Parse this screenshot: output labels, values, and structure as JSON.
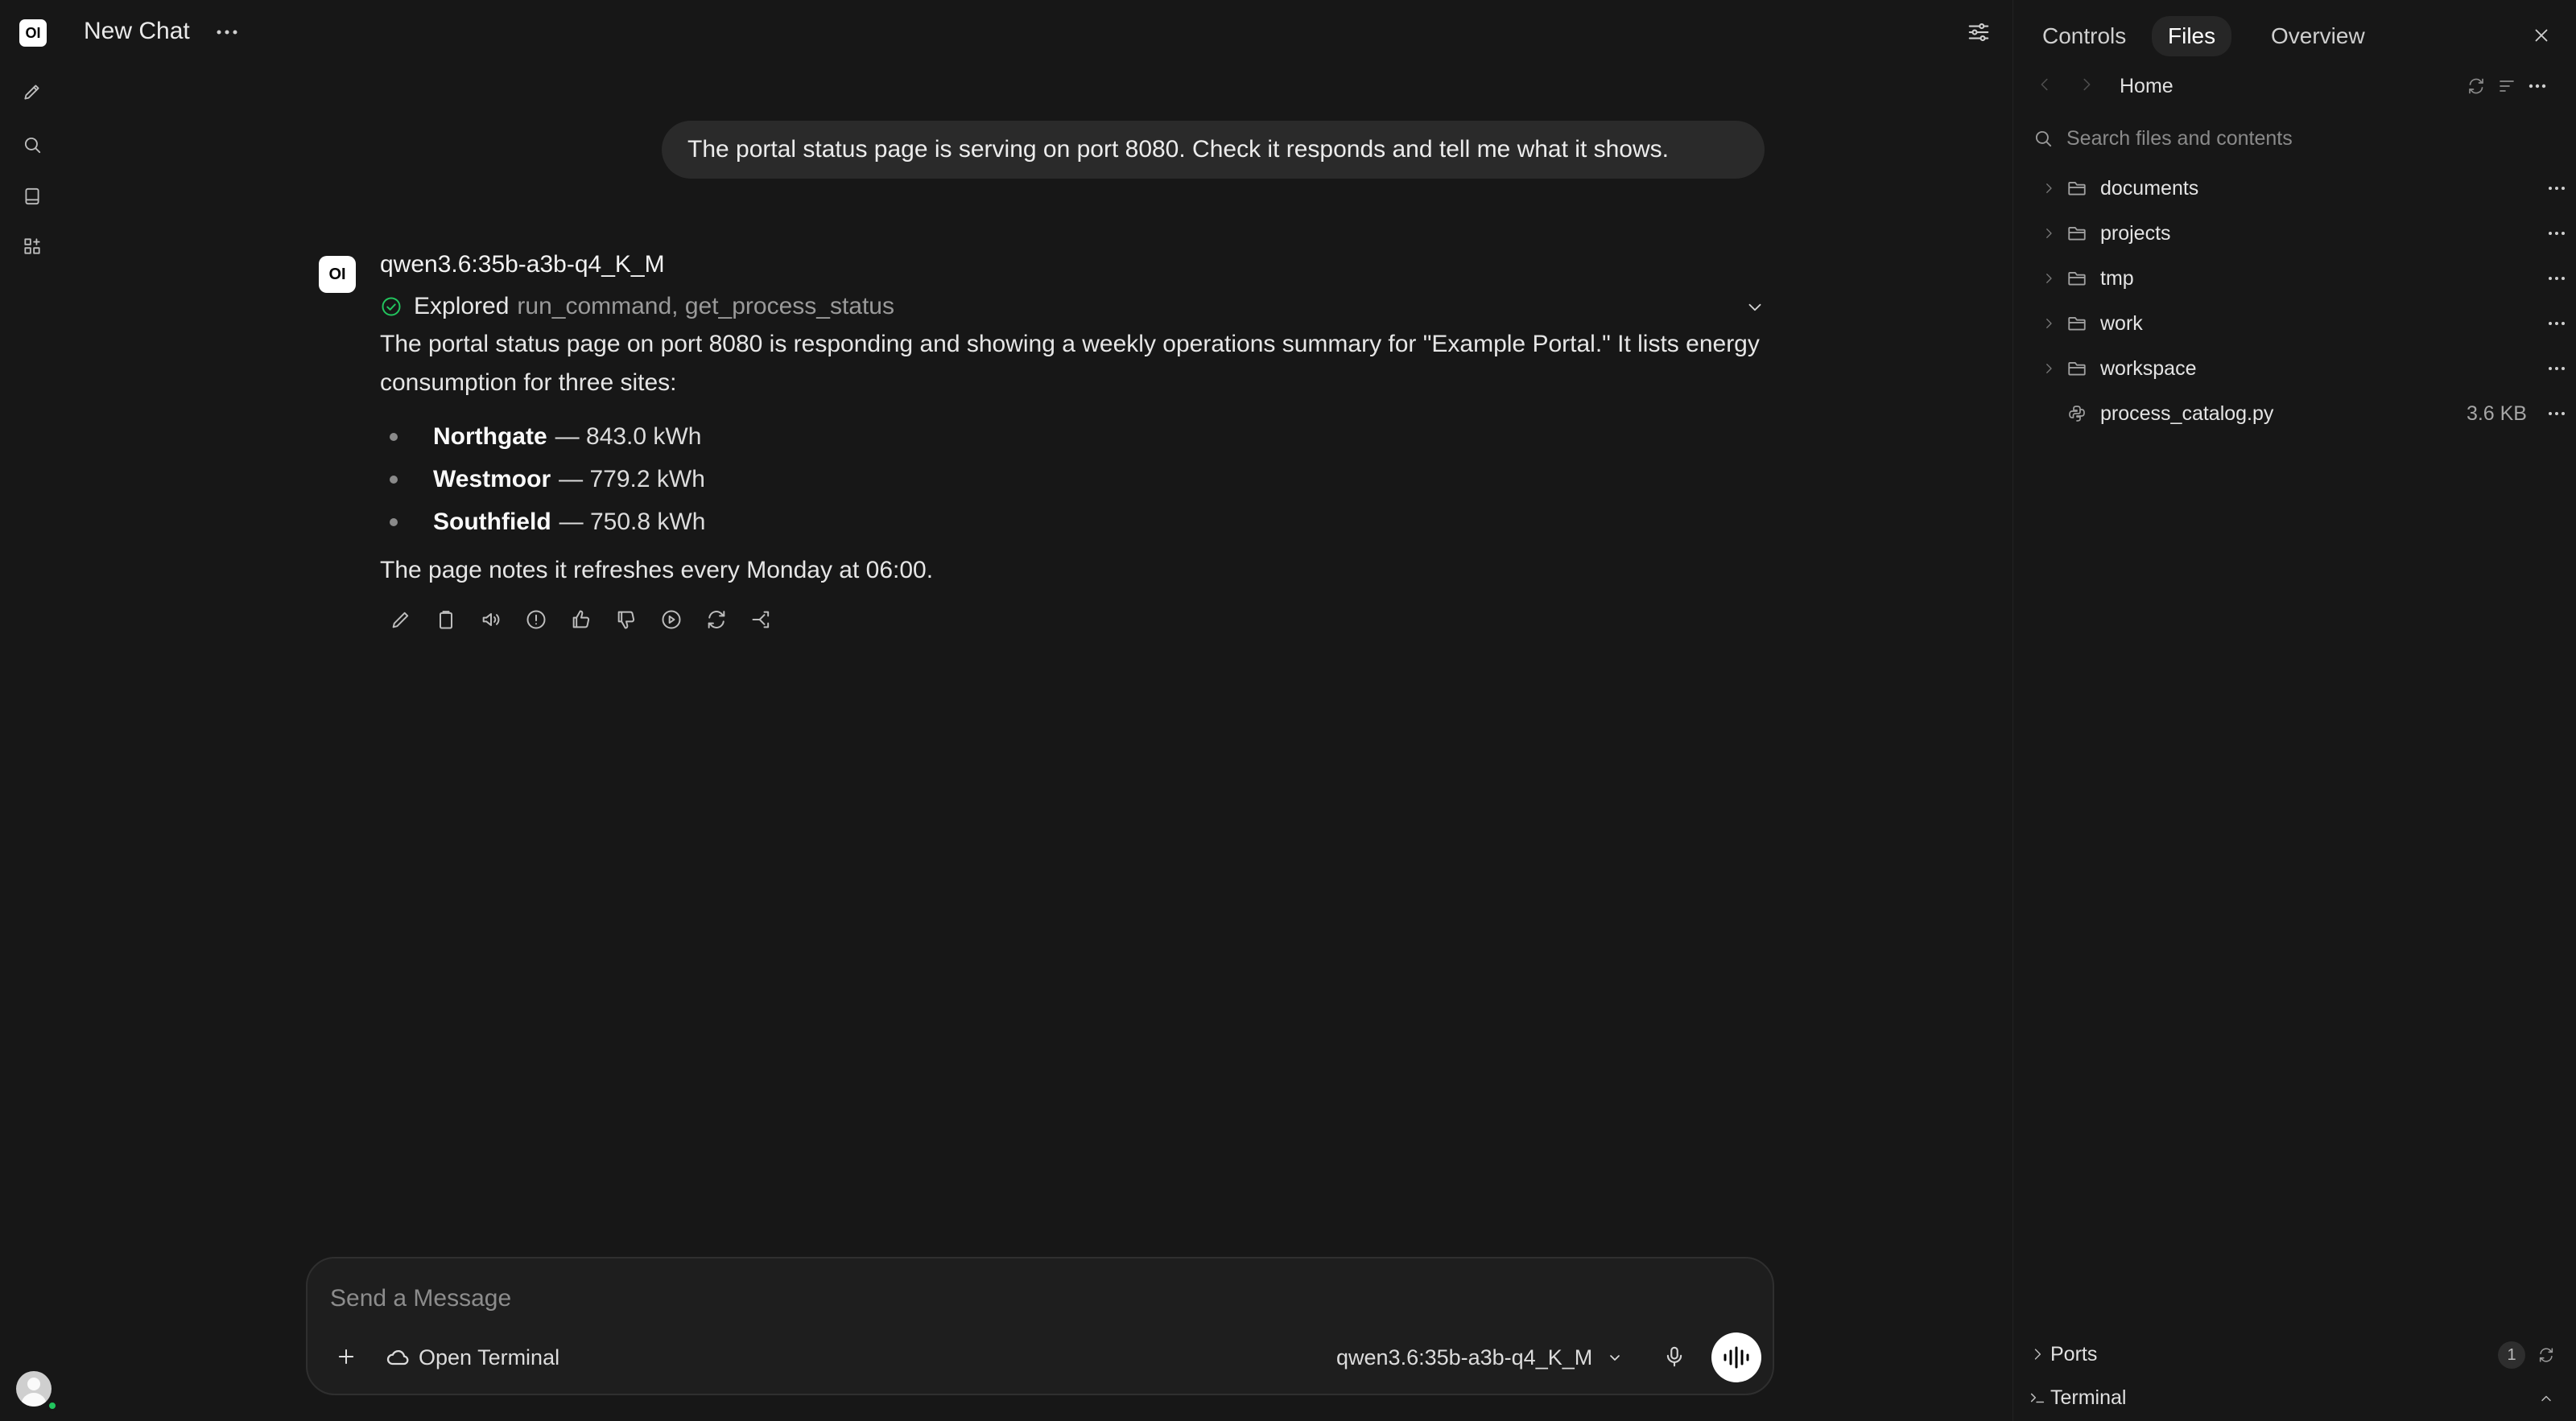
{
  "app": {
    "logo_text": "OI",
    "chat_title": "New Chat"
  },
  "sidebar": {
    "items": [
      {
        "icon": "pencil-icon",
        "label": "New Chat"
      },
      {
        "icon": "search-icon",
        "label": "Search"
      },
      {
        "icon": "notebook-icon",
        "label": "Notes"
      },
      {
        "icon": "grid-icon",
        "label": "Workspace"
      }
    ]
  },
  "conversation": {
    "user_message": "The portal status page is serving on port 8080. Check it responds and tell me what it shows.",
    "assistant": {
      "avatar_text": "OI",
      "model": "qwen3.6:35b-a3b-q4_K_M",
      "tool_status": {
        "verb": "Explored",
        "tools": "run_command, get_process_status"
      },
      "paragraph": "The portal status page on port 8080 is responding and showing a weekly operations summary for \"Example Portal.\" It lists energy consumption for three sites:",
      "items": [
        {
          "site": "Northgate",
          "value": "— 843.0 kWh"
        },
        {
          "site": "Westmoor",
          "value": "— 779.2 kWh"
        },
        {
          "site": "Southfield",
          "value": "— 750.8 kWh"
        }
      ],
      "note": "The page notes it refreshes every Monday at 06:00.",
      "actions": [
        "edit-icon",
        "copy-icon",
        "read-aloud-icon",
        "info-icon",
        "thumbs-up-icon",
        "thumbs-down-icon",
        "continue-icon",
        "regenerate-icon",
        "branch-icon"
      ]
    }
  },
  "composer": {
    "placeholder": "Send a Message",
    "open_terminal_label": "Open Terminal",
    "model": "qwen3.6:35b-a3b-q4_K_M"
  },
  "panel": {
    "tabs": [
      {
        "label": "Controls",
        "active": false
      },
      {
        "label": "Files",
        "active": true
      },
      {
        "label": "Overview",
        "active": false
      }
    ],
    "breadcrumb": "Home",
    "search_placeholder": "Search files and contents",
    "files": [
      {
        "name": "documents",
        "type": "folder",
        "size": ""
      },
      {
        "name": "projects",
        "type": "folder",
        "size": ""
      },
      {
        "name": "tmp",
        "type": "folder",
        "size": ""
      },
      {
        "name": "work",
        "type": "folder",
        "size": ""
      },
      {
        "name": "workspace",
        "type": "folder",
        "size": ""
      },
      {
        "name": "process_catalog.py",
        "type": "file",
        "size": "3.6 KB"
      }
    ],
    "ports_label": "Ports",
    "ports_count": "1",
    "terminal_label": "Terminal"
  },
  "colors": {
    "background": "#171717",
    "bubble": "#2a2a2a",
    "success": "#22c55e",
    "panel_tab_active": "#262626"
  }
}
